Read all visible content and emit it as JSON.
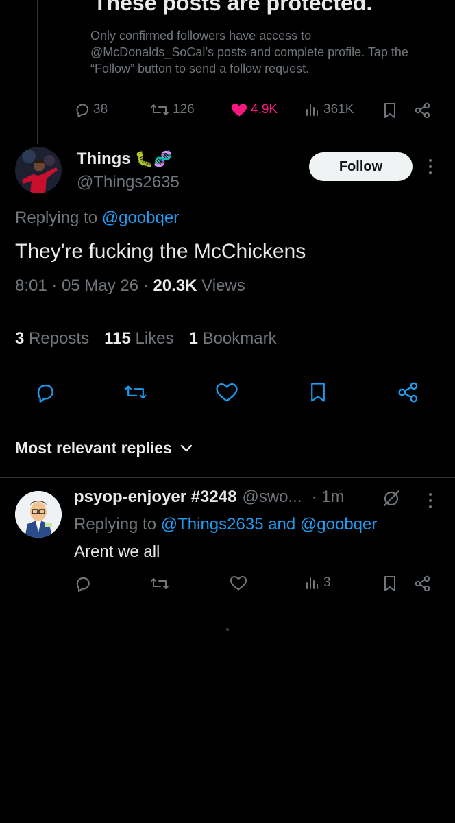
{
  "protected_post": {
    "title": "These posts are protected.",
    "description": "Only confirmed followers have access to @McDonalds_SoCal’s posts and complete profile. Tap the “Follow” button to send a follow request.",
    "stats": {
      "replies": "38",
      "reposts": "126",
      "likes": "4.9K",
      "views": "361K"
    }
  },
  "tweet": {
    "display_name": "Things",
    "emoji": "🐛🧬",
    "handle": "@Things2635",
    "follow_label": "Follow",
    "replying_prefix": "Replying to ",
    "replying_to": "@goobqer",
    "text": "They're fucking the McChickens",
    "time": "8:01",
    "date": "05 May 26",
    "views_count": "20.3K",
    "views_label": "Views",
    "reposts_count": "3",
    "reposts_label": "Reposts",
    "likes_count": "115",
    "likes_label": "Likes",
    "bookmarks_count": "1",
    "bookmarks_label": "Bookmark"
  },
  "replies_sort": {
    "label": "Most relevant replies"
  },
  "reply": {
    "display_name": "psyop-enjoyer #3248",
    "handle": "@swo...",
    "time": "· 1m",
    "replying_prefix": "Replying to ",
    "replying_to": "@Things2635 and @goobqer",
    "text": "Arent we all",
    "views": "3"
  },
  "colors": {
    "background": "#000000",
    "text_primary": "#e7e9ea",
    "text_secondary": "#71767b",
    "link": "#1d9bf0",
    "like": "#f91880",
    "divider": "#2f3336"
  }
}
